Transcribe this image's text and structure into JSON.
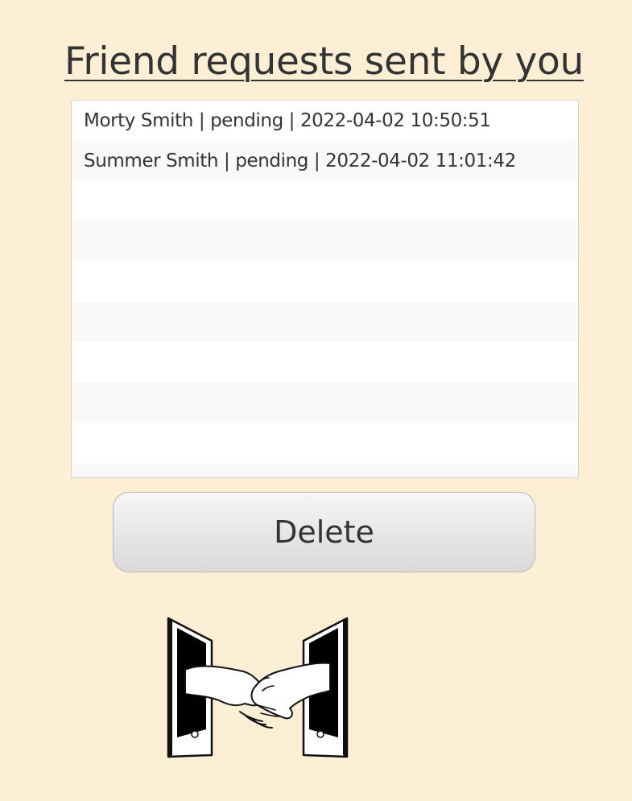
{
  "page": {
    "title": "Friend requests sent by you"
  },
  "requests_list": {
    "items": [
      "Morty Smith | pending | 2022-04-02 10:50:51",
      "Summer Smith | pending | 2022-04-02 11:01:42",
      "",
      "",
      "",
      "",
      "",
      "",
      "",
      ""
    ]
  },
  "actions": {
    "delete_label": "Delete"
  },
  "illustration": {
    "icon": "handshake-phones-icon"
  },
  "colors": {
    "background": "#fdeed6",
    "text": "#333333",
    "list_bg": "#ffffff",
    "list_alt_row": "#f9f9f9",
    "list_border": "#d2d2d2"
  }
}
